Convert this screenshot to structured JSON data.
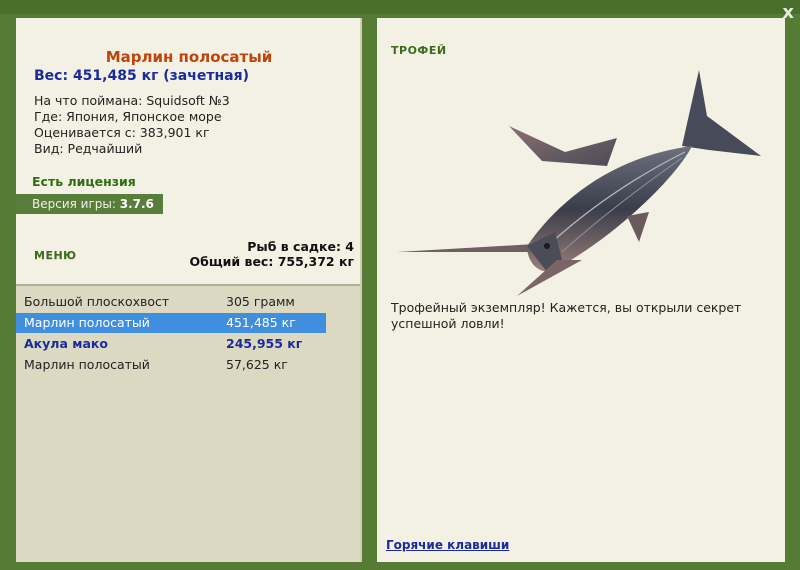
{
  "window": {
    "close_label": "x"
  },
  "fish": {
    "title": "Марлин полосатый",
    "weight": "Вес: 451,485 кг (зачетная)",
    "caught_with": "На что поймана: Squidsoft №3",
    "where": "Где: Япония, Японское море",
    "valued": "Оценивается с: 383,901 кг",
    "kind": "Вид: Редчайший"
  },
  "license": "Есть лицензия",
  "version": {
    "label": "Версия игры:",
    "value": "3.7.6"
  },
  "menu_label": "МЕНЮ",
  "stats": {
    "fish_in_net": "Рыб в садке: 4",
    "total_weight": "Общий вес: 755,372 кг"
  },
  "catch_list": [
    {
      "name": "Большой плоскохвост",
      "weight": "305 грамм",
      "state": "normal"
    },
    {
      "name": "Марлин полосатый",
      "weight": "451,485 кг",
      "state": "selected"
    },
    {
      "name": "Акула мако",
      "weight": "245,955 кг",
      "state": "bold"
    },
    {
      "name": "Марлин полосатый",
      "weight": "57,625 кг",
      "state": "normal"
    }
  ],
  "trophy": {
    "title": "ТРОФЕЙ",
    "text": "Трофейный экземпляр! Кажется, вы открыли секрет успешной ловли!"
  },
  "hotkeys_label": "Горячие клавиши",
  "colors": {
    "frame_green": "#557b34",
    "panel_bg": "#f3f1e4",
    "selection_blue": "#3f8fde",
    "title_orange": "#c0430c",
    "text_blue": "#1c2b9c"
  }
}
